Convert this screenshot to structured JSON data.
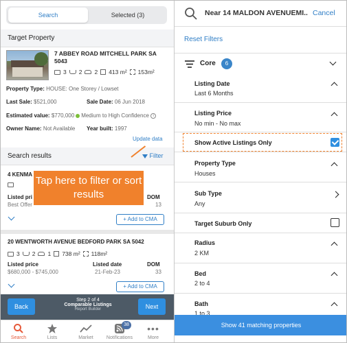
{
  "left": {
    "segment": {
      "search": "Search",
      "selected": "Selected (3)"
    },
    "target_header": "Target Property",
    "target": {
      "address": "7 ABBEY ROAD MITCHELL PARK SA 5043",
      "beds": "3",
      "baths": "2",
      "cars": "2",
      "floor": "413 m²",
      "land": "153m²",
      "property_type_label": "Property Type:",
      "property_type": "HOUSE: One Storey / Lowset",
      "last_sale_label": "Last Sale:",
      "last_sale": "$521,000",
      "sale_date_label": "Sale Date:",
      "sale_date": "06 Jun 2018",
      "estimated_label": "Estimated value:",
      "estimated": "$770,000",
      "confidence": "Medium to High Confidence",
      "owner_label": "Owner Name:",
      "owner": "Not Available",
      "year_label": "Year built:",
      "year": "1997",
      "update": "Update data"
    },
    "results_header": "Search results",
    "filter": "Filter",
    "result1": {
      "address": "4 KENMA",
      "listed_label": "Listed pri",
      "listed_value": "Best Offer",
      "dom_label": "DOM",
      "dom": "13",
      "cma": "Add to CMA"
    },
    "result2": {
      "address": "20 WENTWORTH AVENUE BEDFORD PARK SA 5042",
      "beds": "3",
      "baths": "2",
      "cars": "1",
      "floor": "738 m²",
      "land": "118m²",
      "listed_label": "Listed price",
      "listed_value": "$680,000 - $745,000",
      "date_label": "Listed date",
      "date_value": "21-Feb-23",
      "dom_label": "DOM",
      "dom": "33",
      "cma": "Add to CMA"
    },
    "callout": "Tap here to filter or sort results",
    "stepper": {
      "back": "Back",
      "next": "Next",
      "step": "Step 2 of 4",
      "title": "Comparable Listings",
      "sub": "Report Builder"
    },
    "tabs": [
      {
        "label": "Search",
        "icon": "search-icon"
      },
      {
        "label": "Lists",
        "icon": "star-icon"
      },
      {
        "label": "Market",
        "icon": "chart-icon"
      },
      {
        "label": "Notifications",
        "icon": "feed-icon",
        "badge": "38"
      },
      {
        "label": "More",
        "icon": "more-icon"
      }
    ],
    "colors": {
      "accent": "#2f7ec6",
      "callout": "#f0812c",
      "active_tab": "#e65a3a"
    }
  },
  "right": {
    "search_text": "Near 14 MALDON AVENUEMI...",
    "cancel": "Cancel",
    "reset": "Reset Filters",
    "core_label": "Core",
    "core_count": "6",
    "filters": [
      {
        "title": "Listing Date",
        "value": "Last 6 Months"
      },
      {
        "title": "Listing Price",
        "value": "No min - No max"
      },
      {
        "title": "Show Active Listings Only",
        "checked": true
      },
      {
        "title": "Property Type",
        "value": "Houses"
      },
      {
        "title": "Sub Type",
        "value": "Any"
      },
      {
        "title": "Target Suburb Only",
        "checked": false
      },
      {
        "title": "Radius",
        "value": "2 KM"
      },
      {
        "title": "Bed",
        "value": "2 to 4"
      },
      {
        "title": "Bath",
        "value": "1 to 3"
      }
    ],
    "show_button": "Show 41 matching properties"
  }
}
